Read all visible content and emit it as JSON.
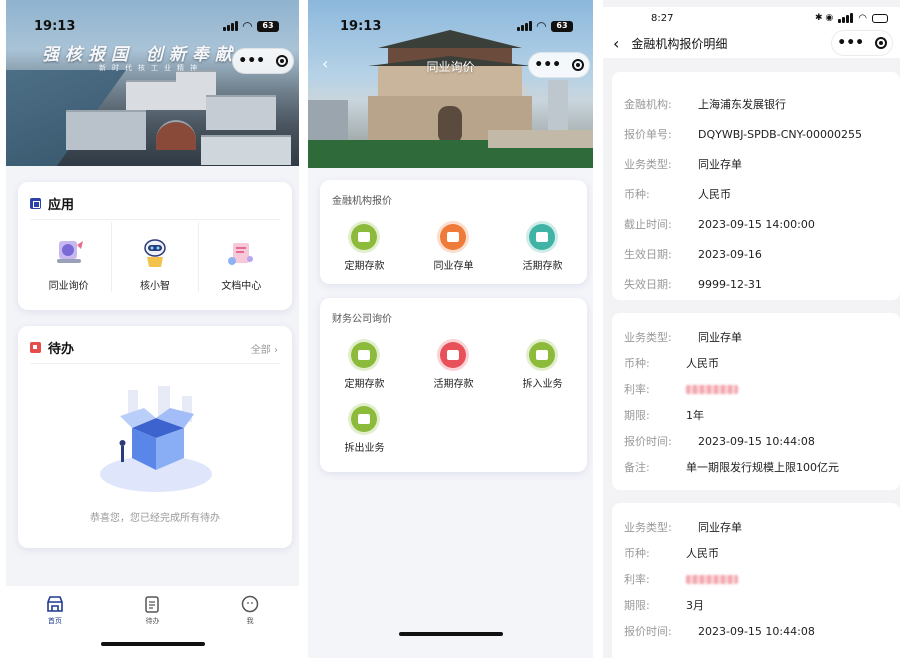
{
  "p1": {
    "time": "19:13",
    "battery": "63",
    "banner": {
      "slogan": "强核报国  创新奉献",
      "sub": "新时代核工业精神"
    },
    "apps_title": "应用",
    "apps": [
      {
        "label": "同业询价",
        "icon": "inquiry-illustration-icon"
      },
      {
        "label": "核小智",
        "icon": "robot-assistant-icon"
      },
      {
        "label": "文档中心",
        "icon": "document-center-icon"
      }
    ],
    "todo_title": "待办",
    "todo_more": "全部",
    "empty_text": "恭喜您，您已经完成所有待办",
    "tabs": [
      {
        "label": "首页",
        "icon": "home-store-icon",
        "active": true
      },
      {
        "label": "待办",
        "icon": "clipboard-icon",
        "active": false
      },
      {
        "label": "我",
        "icon": "face-icon",
        "active": false
      }
    ],
    "colors": {
      "accent": "#1f3a93",
      "todo": "#e74c4c"
    }
  },
  "p2": {
    "time": "19:13",
    "battery": "63",
    "title": "同业询价",
    "sections": [
      {
        "label": "金融机构报价",
        "items": [
          {
            "label": "定期存款",
            "color": "#8dbb3d",
            "icon": "fixed-deposit-icon"
          },
          {
            "label": "同业存单",
            "color": "#ee7b3a",
            "icon": "certificate-icon"
          },
          {
            "label": "活期存款",
            "color": "#3fb5a6",
            "icon": "demand-deposit-icon"
          }
        ]
      },
      {
        "label": "财务公司询价",
        "items": [
          {
            "label": "定期存款",
            "color": "#8dbb3d",
            "icon": "fixed-deposit-icon"
          },
          {
            "label": "活期存款",
            "color": "#e8505a",
            "icon": "card-icon"
          },
          {
            "label": "拆入业务",
            "color": "#8dbb3d",
            "icon": "wallet-icon"
          },
          {
            "label": "拆出业务",
            "color": "#8dbb3d",
            "icon": "wallet-out-icon"
          }
        ]
      }
    ]
  },
  "p3": {
    "time": "8:27",
    "title": "金融机构报价明细",
    "head": [
      {
        "k": "金融机构:",
        "v": "上海浦东发展银行"
      },
      {
        "k": "报价单号:",
        "v": "DQYWBJ-SPDB-CNY-00000255"
      },
      {
        "k": "业务类型:",
        "v": "同业存单"
      },
      {
        "k": "币种:",
        "v": "人民币"
      },
      {
        "k": "截止时间:",
        "v": "2023-09-15 14:00:00"
      },
      {
        "k": "生效日期:",
        "v": "2023-09-16"
      },
      {
        "k": "失效日期:",
        "v": "9999-12-31"
      }
    ],
    "quote1": [
      {
        "k": "业务类型:",
        "v": "同业存单"
      },
      {
        "k": "币种:",
        "v": "人民币"
      },
      {
        "k": "利率:",
        "v": ""
      },
      {
        "k": "期限:",
        "v": "1年"
      },
      {
        "k": "报价时间:",
        "v": "2023-09-15 10:44:08"
      },
      {
        "k": "备注:",
        "v": "单一期限发行规模上限100亿元"
      }
    ],
    "quote2": [
      {
        "k": "业务类型:",
        "v": "同业存单"
      },
      {
        "k": "币种:",
        "v": "人民币"
      },
      {
        "k": "利率:",
        "v": ""
      },
      {
        "k": "期限:",
        "v": "3月"
      },
      {
        "k": "报价时间:",
        "v": "2023-09-15 10:44:08"
      }
    ]
  }
}
